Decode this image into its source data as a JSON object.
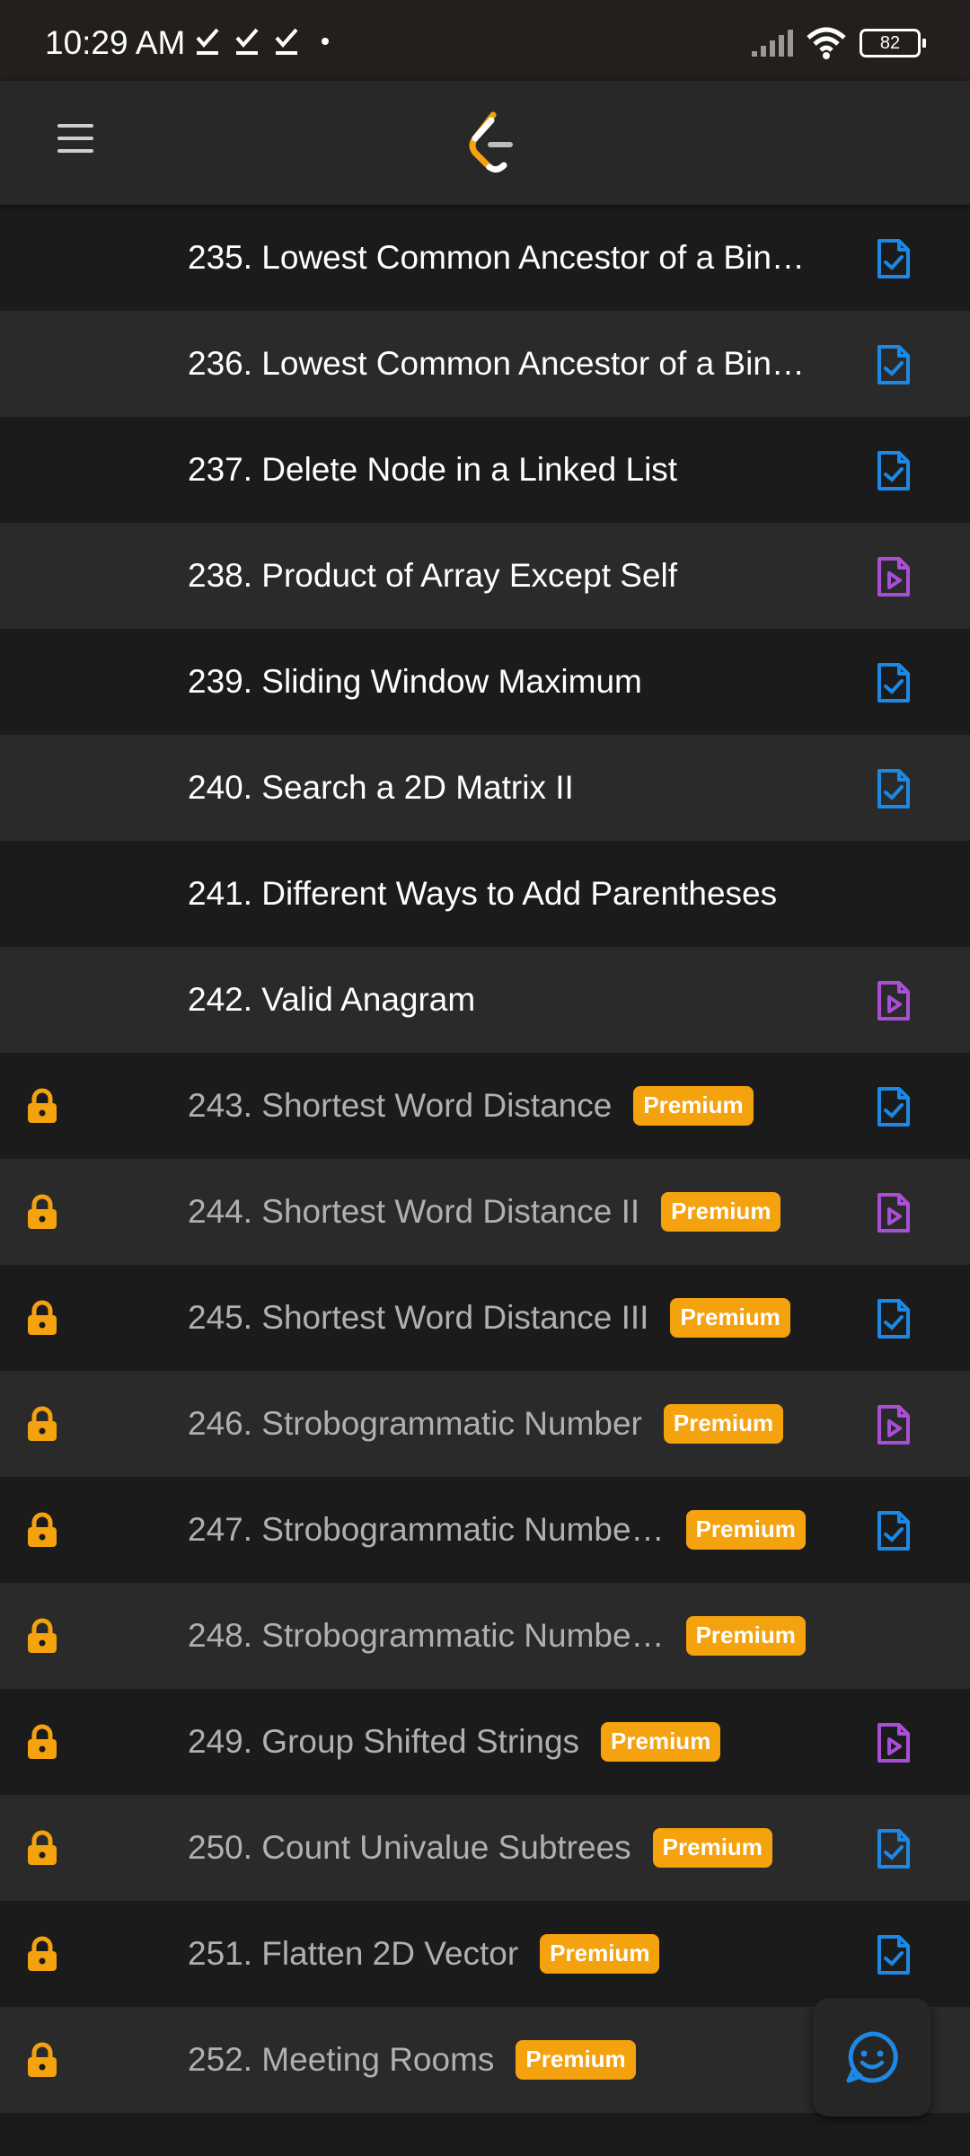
{
  "status_bar": {
    "time": "10:29 AM",
    "battery": "82",
    "icons": [
      "check-download-icon",
      "check-download-icon",
      "check-download-icon",
      "dot-icon",
      "signal-icon",
      "wifi-icon",
      "battery-icon"
    ]
  },
  "app_bar": {
    "menu_icon": "hamburger-menu-icon",
    "logo_icon": "leetcode-logo-icon"
  },
  "colors": {
    "premium_badge": "#f5a20f",
    "lock": "#f5a20f",
    "solution_icon": "#1e88e5",
    "video_icon": "#a94fd6"
  },
  "problems": [
    {
      "title": "235. Lowest Common Ancestor of a Bin…",
      "locked": false,
      "premium": "",
      "icon": "solution-doc-check"
    },
    {
      "title": "236. Lowest Common Ancestor of a Bin…",
      "locked": false,
      "premium": "",
      "icon": "solution-doc-check"
    },
    {
      "title": "237. Delete Node in a Linked List",
      "locked": false,
      "premium": "",
      "icon": "solution-doc-check"
    },
    {
      "title": "238. Product of Array Except Self",
      "locked": false,
      "premium": "",
      "icon": "video-doc-play"
    },
    {
      "title": "239. Sliding Window Maximum",
      "locked": false,
      "premium": "",
      "icon": "solution-doc-check"
    },
    {
      "title": "240. Search a 2D Matrix II",
      "locked": false,
      "premium": "",
      "icon": "solution-doc-check"
    },
    {
      "title": "241. Different Ways to Add Parentheses",
      "locked": false,
      "premium": "",
      "icon": ""
    },
    {
      "title": "242. Valid Anagram",
      "locked": false,
      "premium": "",
      "icon": "video-doc-play"
    },
    {
      "title": "243. Shortest Word Distance",
      "locked": true,
      "premium": "Premium",
      "icon": "solution-doc-check"
    },
    {
      "title": "244. Shortest Word Distance II",
      "locked": true,
      "premium": "Premium",
      "icon": "video-doc-play"
    },
    {
      "title": "245. Shortest Word Distance III",
      "locked": true,
      "premium": "Premium",
      "icon": "solution-doc-check"
    },
    {
      "title": "246. Strobogrammatic Number",
      "locked": true,
      "premium": "Premium",
      "icon": "video-doc-play"
    },
    {
      "title": "247. Strobogrammatic Numbe…",
      "locked": true,
      "premium": "Premium",
      "icon": "solution-doc-check"
    },
    {
      "title": "248. Strobogrammatic Numbe…",
      "locked": true,
      "premium": "Premium",
      "icon": ""
    },
    {
      "title": "249. Group Shifted Strings",
      "locked": true,
      "premium": "Premium",
      "icon": "video-doc-play"
    },
    {
      "title": "250. Count Univalue Subtrees",
      "locked": true,
      "premium": "Premium",
      "icon": "solution-doc-check"
    },
    {
      "title": "251. Flatten 2D Vector",
      "locked": true,
      "premium": "Premium",
      "icon": "solution-doc-check"
    },
    {
      "title": "252. Meeting Rooms",
      "locked": true,
      "premium": "Premium",
      "icon": ""
    }
  ],
  "fab": {
    "icon": "chat-smiley-icon"
  }
}
